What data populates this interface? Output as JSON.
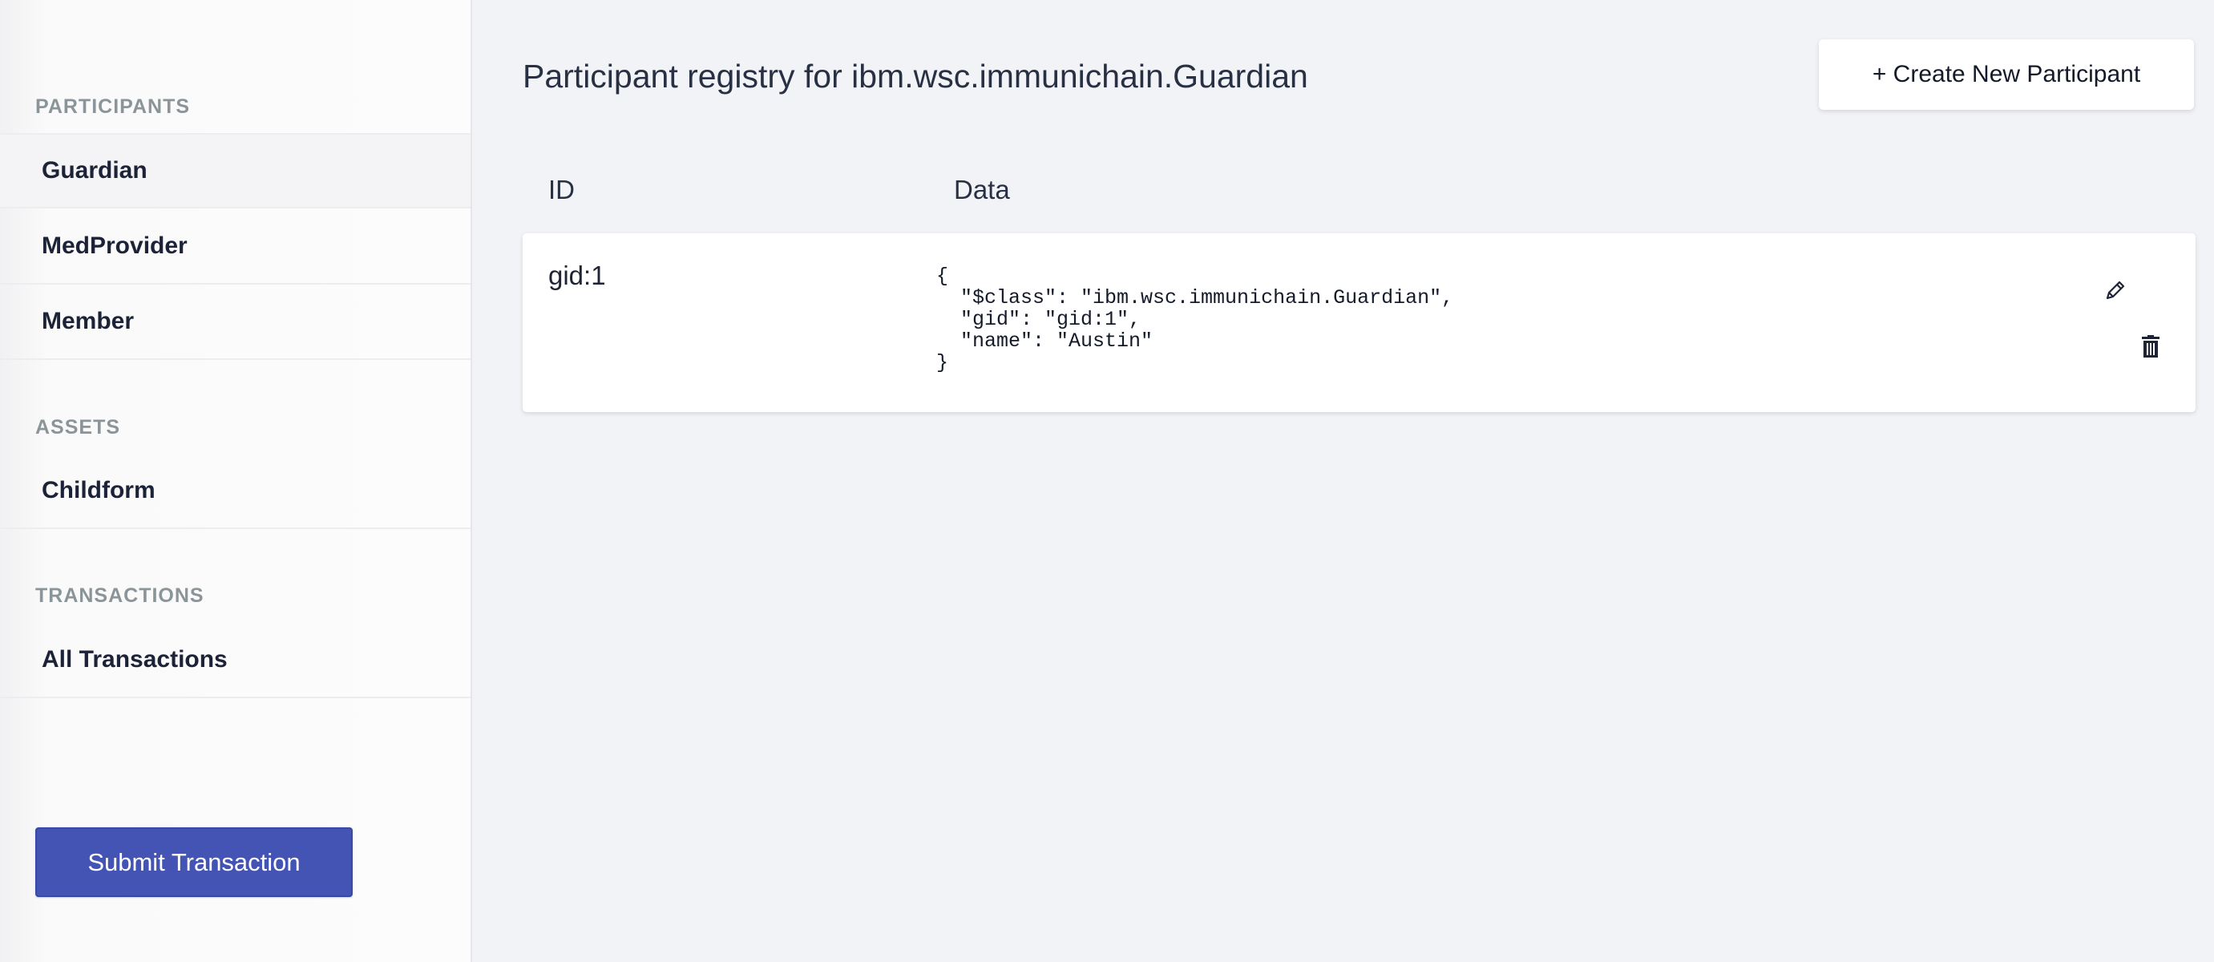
{
  "sidebar": {
    "sections": [
      {
        "title": "PARTICIPANTS",
        "items": [
          {
            "label": "Guardian"
          },
          {
            "label": "MedProvider"
          },
          {
            "label": "Member"
          }
        ]
      },
      {
        "title": "ASSETS",
        "items": [
          {
            "label": "Childform"
          }
        ]
      },
      {
        "title": "TRANSACTIONS",
        "items": [
          {
            "label": "All Transactions"
          }
        ]
      }
    ],
    "submit_label": "Submit Transaction"
  },
  "main": {
    "title": "Participant registry for ibm.wsc.immunichain.Guardian",
    "create_label": "+ Create New Participant",
    "columns": {
      "id": "ID",
      "data": "Data"
    },
    "rows": [
      {
        "id": "gid:1",
        "data": "{\n  \"$class\": \"ibm.wsc.immunichain.Guardian\",\n  \"gid\": \"gid:1\",\n  \"name\": \"Austin\"\n}"
      }
    ]
  },
  "icons": {
    "edit": "pencil-icon",
    "delete": "trash-icon"
  },
  "colors": {
    "accent": "#4354b4",
    "background": "#f2f3f7",
    "sidebar": "#fcfcfc",
    "section_title": "#8a9499",
    "text": "#1c2237"
  }
}
